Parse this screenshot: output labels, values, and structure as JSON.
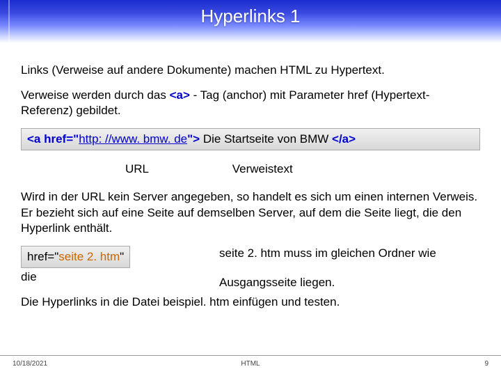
{
  "title": "Hyperlinks 1",
  "p1": "Links (Verweise auf andere Dokumente) machen HTML zu Hypertext.",
  "p2_a": "Verweise werden durch das ",
  "p2_tag": "<a>",
  "p2_b": " - Tag (anchor) mit Parameter href (Hypertext-Referenz) gebildet.",
  "code1_a": "<a href=\"",
  "code1_url": "http: //www. bmw. de",
  "code1_b": "\">",
  "code1_text": " Die Startseite von BMW ",
  "code1_c": "</a>",
  "label_url": "URL",
  "label_vtext": "Verweistext",
  "p3": "Wird in der URL kein Server angegeben, so handelt es sich um einen internen Verweis. Er bezieht sich auf eine Seite auf demselben Server, auf dem die Seite liegt, die den Hyperlink enthält.",
  "code2_a": "href=\"",
  "code2_file": "seite 2. htm",
  "code2_b": "\"",
  "p4_right": "seite 2. htm muss im gleichen Ordner wie",
  "p4_die": "die",
  "p4_line2": "Ausgangsseite liegen.",
  "p5": "Die Hyperlinks in die Datei beispiel. htm einfügen und testen.",
  "footer_date": "10/18/2021",
  "footer_center": "HTML",
  "footer_page": "9"
}
